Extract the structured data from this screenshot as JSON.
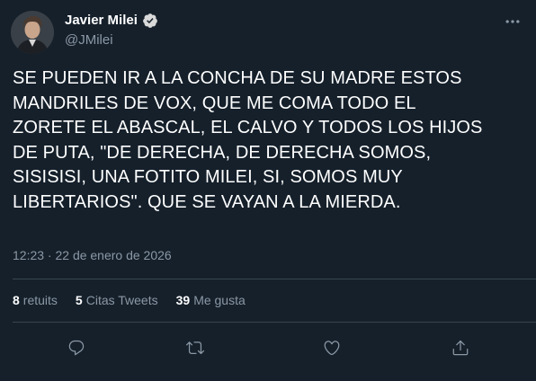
{
  "author": {
    "display_name": "Javier Milei",
    "handle": "@JMilei",
    "verified": true,
    "avatar_icon": "profile-photo"
  },
  "tweet": {
    "text": "SE PUEDEN IR A LA CONCHA DE SU MADRE ESTOS\nMANDRILES DE VOX, QUE ME COMA TODO EL\nZORETE EL ABASCAL, EL CALVO Y TODOS LOS HIJOS\nDE PUTA, \"DE DERECHA, DE DERECHA SOMOS,\nSISISISI, UNA FOTITO MILEI, SI, SOMOS MUY\nLIBERTARIOS\". QUE SE VAYAN A LA MIERDA.",
    "timestamp": "12:23 · 22 de enero de 2026"
  },
  "stats": {
    "retweets_count": "8",
    "retweets_label": "retuits",
    "quotes_count": "5",
    "quotes_label": "Citas Tweets",
    "likes_count": "39",
    "likes_label": "Me gusta"
  },
  "actions": {
    "reply_icon": "reply-icon",
    "retweet_icon": "retweet-icon",
    "like_icon": "heart-icon",
    "share_icon": "share-icon"
  },
  "colors": {
    "background": "#15202b",
    "primary_text": "#ffffff",
    "secondary_text": "#8b98a5",
    "divider": "#38444d",
    "verified": "#d9d9d9"
  }
}
